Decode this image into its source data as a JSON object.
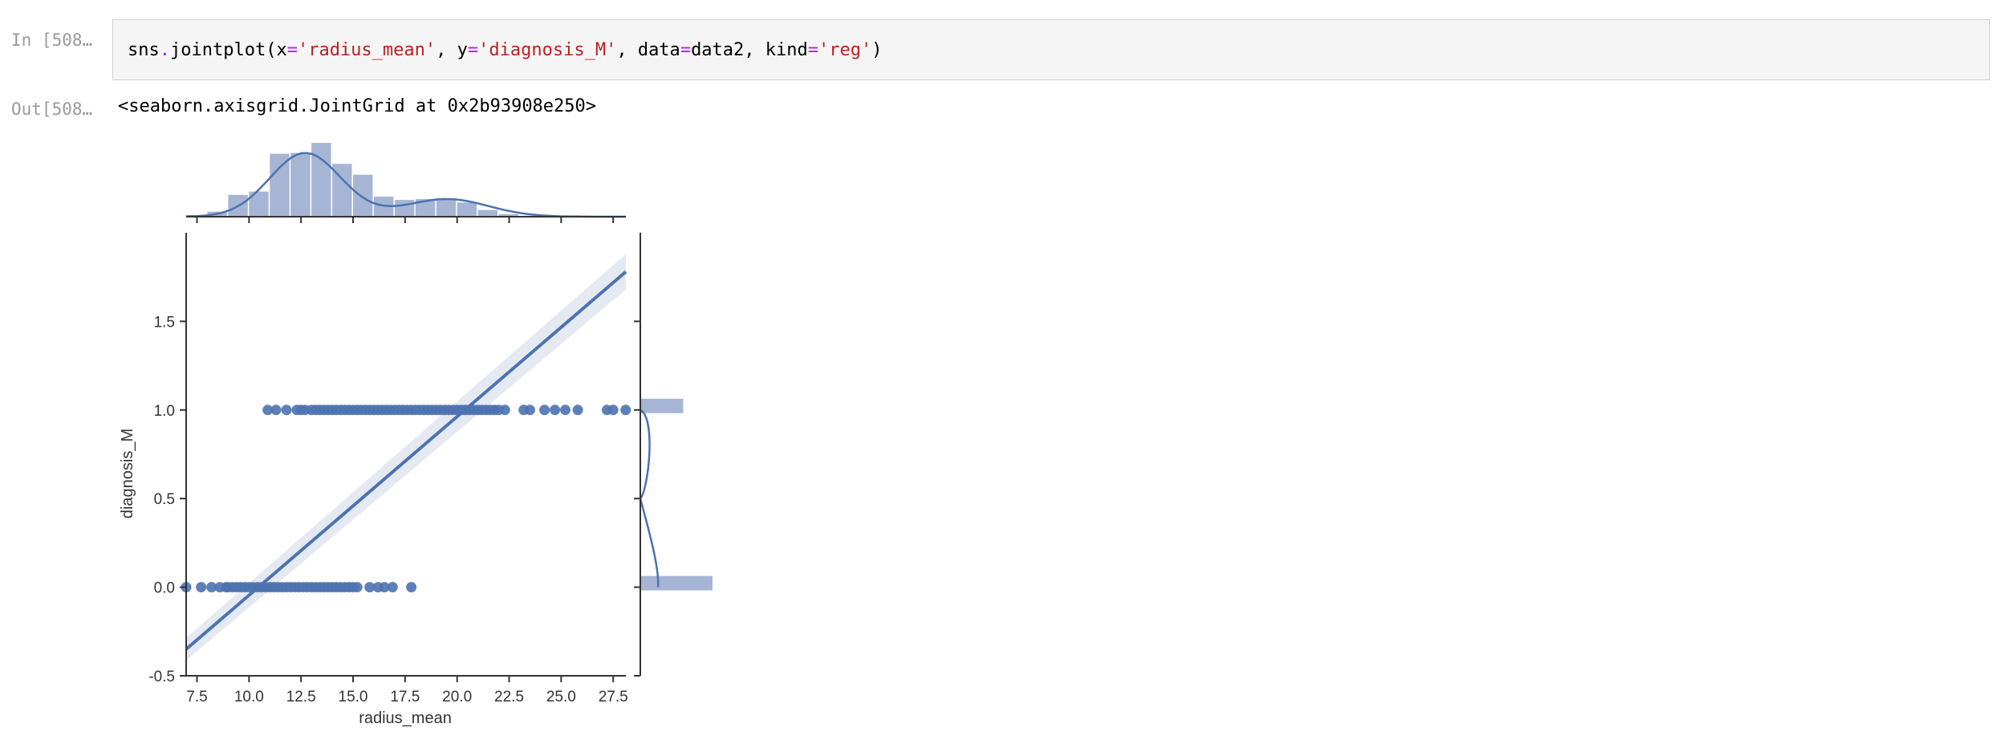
{
  "input_prompt": "In [508…",
  "output_prompt": "Out[508…",
  "code": {
    "p1": "sns",
    "p2": ".",
    "p3": "jointplot(x",
    "p4": "=",
    "p5": "'radius_mean'",
    "p6": ", y",
    "p7": "=",
    "p8": "'diagnosis_M'",
    "p9": ", data",
    "p10": "=",
    "p11": "data2, kind",
    "p12": "=",
    "p13": "'reg'",
    "p14": ")"
  },
  "output_text": "<seaborn.axisgrid.JointGrid at 0x2b93908e250>",
  "colors": {
    "series": "#4c72b0",
    "hist_fill": "#a7b5d5",
    "ci_band": "#dfe4ef"
  },
  "chart_data": {
    "type": "scatter",
    "xlabel": "radius_mean",
    "ylabel": "diagnosis_M",
    "xlim": [
      6.98,
      28.11
    ],
    "ylim": [
      -0.5,
      2.0
    ],
    "xticks": [
      "7.5",
      "10.0",
      "12.5",
      "15.0",
      "17.5",
      "20.0",
      "22.5",
      "25.0",
      "27.5"
    ],
    "xtick_values": [
      7.5,
      10.0,
      12.5,
      15.0,
      17.5,
      20.0,
      22.5,
      25.0,
      27.5
    ],
    "yticks": [
      "-0.5",
      "0.0",
      "0.5",
      "1.0",
      "1.5"
    ],
    "ytick_values": [
      -0.5,
      0.0,
      0.5,
      1.0,
      1.5
    ],
    "regression": {
      "x": [
        6.98,
        28.11
      ],
      "y": [
        -0.35,
        1.78
      ]
    },
    "points_diagnosis_0": [
      6.98,
      7.7,
      8.2,
      8.6,
      8.9,
      9.0,
      9.2,
      9.4,
      9.6,
      9.8,
      10.0,
      10.2,
      10.4,
      10.6,
      10.8,
      11.0,
      11.2,
      11.4,
      11.6,
      11.8,
      12.0,
      12.2,
      12.4,
      12.6,
      12.8,
      13.0,
      13.2,
      13.4,
      13.6,
      13.8,
      14.0,
      14.2,
      14.4,
      14.6,
      14.8,
      15.0,
      15.2,
      15.8,
      16.2,
      16.5,
      16.9,
      17.8
    ],
    "points_diagnosis_1": [
      10.9,
      11.3,
      11.8,
      12.3,
      12.5,
      12.7,
      13.0,
      13.2,
      13.4,
      13.6,
      13.8,
      14.0,
      14.2,
      14.4,
      14.6,
      14.8,
      15.0,
      15.2,
      15.4,
      15.6,
      15.8,
      16.0,
      16.2,
      16.4,
      16.6,
      16.8,
      17.0,
      17.2,
      17.4,
      17.6,
      17.8,
      18.0,
      18.2,
      18.4,
      18.6,
      18.8,
      19.0,
      19.2,
      19.4,
      19.6,
      19.8,
      20.0,
      20.2,
      20.4,
      20.6,
      20.8,
      21.0,
      21.2,
      21.4,
      21.6,
      21.8,
      22.0,
      22.3,
      23.2,
      23.5,
      24.2,
      24.7,
      25.2,
      25.8,
      27.2,
      27.5,
      28.1
    ],
    "marginal_x_histogram": {
      "bin_edges": [
        6.98,
        8.0,
        9.0,
        10.0,
        11.0,
        12.0,
        13.0,
        14.0,
        15.0,
        16.0,
        17.0,
        18.0,
        19.0,
        20.0,
        21.0,
        22.0,
        23.0,
        24.0,
        25.0,
        26.0,
        27.0,
        28.11
      ],
      "counts": [
        2,
        6,
        26,
        30,
        75,
        76,
        88,
        63,
        50,
        24,
        20,
        21,
        22,
        17,
        8,
        3,
        1,
        1,
        1,
        1,
        1
      ]
    },
    "marginal_y_histogram": {
      "levels": [
        0,
        1
      ],
      "counts": [
        357,
        212
      ]
    }
  }
}
